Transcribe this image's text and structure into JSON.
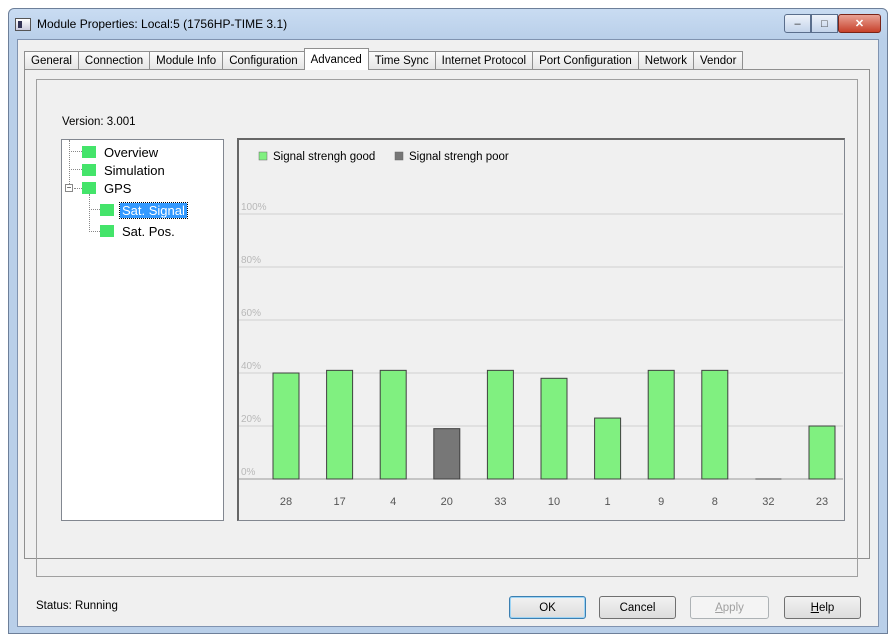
{
  "window": {
    "title": "Module Properties: Local:5 (1756HP-TIME 3.1)",
    "controls": [
      "minimize",
      "maximize",
      "close"
    ]
  },
  "tabs": [
    {
      "label": "General"
    },
    {
      "label": "Connection"
    },
    {
      "label": "Module Info"
    },
    {
      "label": "Configuration"
    },
    {
      "label": "Advanced",
      "active": true
    },
    {
      "label": "Time Sync"
    },
    {
      "label": "Internet Protocol"
    },
    {
      "label": "Port Configuration"
    },
    {
      "label": "Network"
    },
    {
      "label": "Vendor"
    }
  ],
  "version": "Version: 3.001",
  "tree": {
    "items": [
      {
        "label": "Overview"
      },
      {
        "label": "Simulation"
      },
      {
        "label": "GPS"
      },
      {
        "label": "Sat. Signal",
        "selected": true
      },
      {
        "label": "Sat. Pos."
      }
    ],
    "node_color": "#44e46a"
  },
  "chart_data": {
    "type": "bar",
    "categories": [
      "28",
      "17",
      "4",
      "20",
      "33",
      "10",
      "1",
      "9",
      "8",
      "32",
      "23"
    ],
    "values": [
      40,
      41,
      41,
      19,
      41,
      38,
      23,
      41,
      41,
      0,
      20
    ],
    "status": [
      "good",
      "good",
      "good",
      "poor",
      "good",
      "good",
      "good",
      "good",
      "good",
      "good",
      "good"
    ],
    "legend": [
      {
        "label": "Signal strengh good",
        "color": "#80f080"
      },
      {
        "label": "Signal strengh poor",
        "color": "#777777"
      }
    ],
    "yticks": [
      "0%",
      "20%",
      "40%",
      "60%",
      "80%",
      "100%"
    ],
    "ylim": [
      0,
      100
    ],
    "grid": true,
    "legend_position": "top-left"
  },
  "status": {
    "label": "Status:",
    "value": "Running"
  },
  "buttons": {
    "ok": "OK",
    "cancel": "Cancel",
    "apply_pre": "",
    "apply_u": "A",
    "apply_post": "pply",
    "help_pre": "",
    "help_u": "H",
    "help_post": "elp"
  }
}
